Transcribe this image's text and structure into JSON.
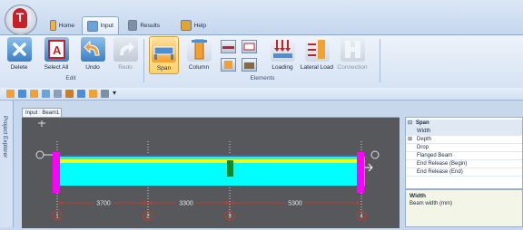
{
  "tabs": [
    {
      "label": "Home"
    },
    {
      "label": "Input"
    },
    {
      "label": "Results"
    },
    {
      "label": "Help"
    }
  ],
  "ribbon": {
    "edit_group": "Edit",
    "elements_group": "Elements",
    "buttons": {
      "delete": "Delete",
      "select_all": "Select All",
      "undo": "Undo",
      "redo": "Redo",
      "span": "Span",
      "column": "Column",
      "loading": "Loading",
      "lateral_load": "Lateral Load",
      "connection": "Connection"
    }
  },
  "sidebar": {
    "label": "Project Explorer"
  },
  "document": {
    "tab": "Input : Beam1"
  },
  "drawing": {
    "dimensions": [
      "3700",
      "3300",
      "5300"
    ],
    "grid_labels": [
      "1",
      "2",
      "3",
      "4"
    ]
  },
  "properties": {
    "rows": [
      {
        "label": "Span",
        "type": "category"
      },
      {
        "label": "Width",
        "type": "selected"
      },
      {
        "label": "Depth",
        "type": "category-row"
      },
      {
        "label": "Drop",
        "type": "item"
      },
      {
        "label": "Flanged Beam",
        "type": "item"
      },
      {
        "label": "End Release (Begin)",
        "type": "item"
      },
      {
        "label": "End Release (End)",
        "type": "item"
      }
    ],
    "description_title": "Width",
    "description_text": "Beam width (mm)"
  },
  "colors": {
    "beam": "#00ffff",
    "beam_top": "#ffff00",
    "supports": "#ff00ff",
    "column_marker": "#0b8a2d",
    "dimension_line": "#c63a2a"
  }
}
